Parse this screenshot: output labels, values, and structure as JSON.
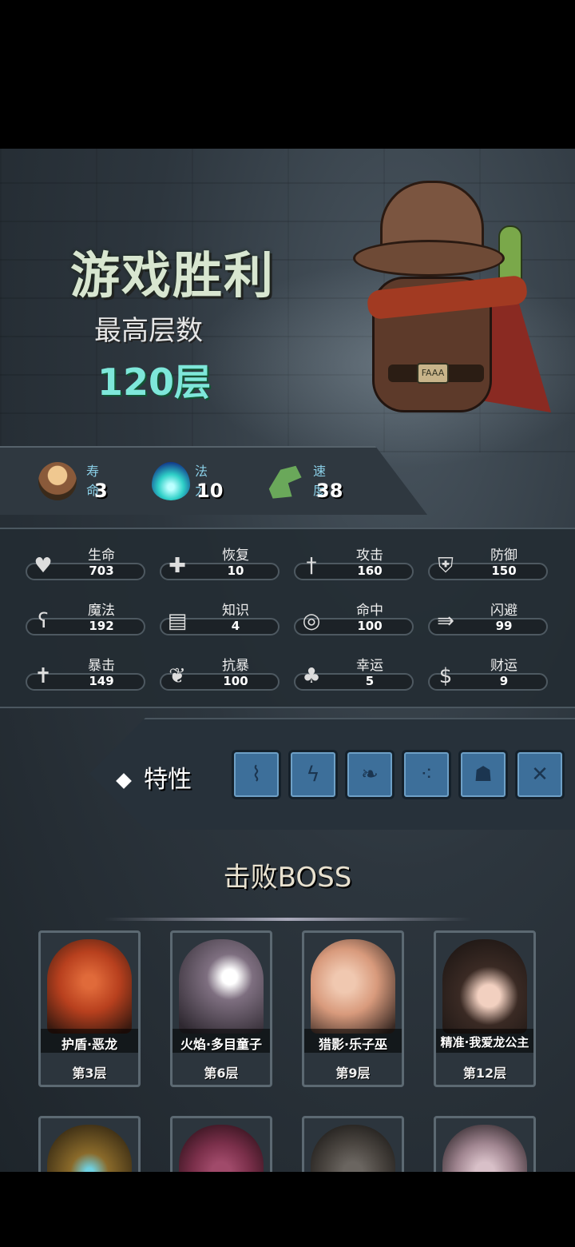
{
  "result": {
    "title": "游戏胜利",
    "floor_label": "最高层数",
    "floor_value": "120层"
  },
  "primary_stats": [
    {
      "label": "寿命",
      "value": "3",
      "icon": "lives-icon"
    },
    {
      "label": "法力",
      "value": "10",
      "icon": "mana-flame-icon"
    },
    {
      "label": "速度",
      "value": "38",
      "icon": "winged-boot-icon"
    }
  ],
  "stats": [
    {
      "label": "生命",
      "value": "703",
      "icon": "heart-icon"
    },
    {
      "label": "恢复",
      "value": "10",
      "icon": "heart-plus-icon"
    },
    {
      "label": "攻击",
      "value": "160",
      "icon": "sword-icon"
    },
    {
      "label": "防御",
      "value": "150",
      "icon": "armor-icon"
    },
    {
      "label": "魔法",
      "value": "192",
      "icon": "staff-icon"
    },
    {
      "label": "知识",
      "value": "4",
      "icon": "book-icon"
    },
    {
      "label": "命中",
      "value": "100",
      "icon": "target-icon"
    },
    {
      "label": "闪避",
      "value": "99",
      "icon": "dodge-arrows-icon"
    },
    {
      "label": "暴击",
      "value": "149",
      "icon": "crit-cross-icon"
    },
    {
      "label": "抗暴",
      "value": "100",
      "icon": "crit-resist-icon"
    },
    {
      "label": "幸运",
      "value": "5",
      "icon": "clover-icon"
    },
    {
      "label": "财运",
      "value": "9",
      "icon": "coin-icon"
    }
  ],
  "traits": {
    "label": "特性",
    "items": [
      {
        "icon": "sash-icon"
      },
      {
        "icon": "lightning-crack-icon"
      },
      {
        "icon": "leaf-branch-icon"
      },
      {
        "icon": "bullets-icon"
      },
      {
        "icon": "bandit-icon"
      },
      {
        "icon": "crossed-guns-icon"
      }
    ]
  },
  "bosses": {
    "title": "击败BOSS",
    "items": [
      {
        "name": "护盾·恶龙",
        "floor": "第3层",
        "color": "#b8401e"
      },
      {
        "name": "火焰·多目童子",
        "floor": "第6层",
        "color": "#7e6f80"
      },
      {
        "name": "猎影·乐子巫",
        "floor": "第9层",
        "color": "#d89a7c"
      },
      {
        "name": "精准·我爱龙公主",
        "floor": "第12层",
        "color": "#3a2a24"
      },
      {
        "name": "",
        "floor": "",
        "color": "#8a6a2a"
      },
      {
        "name": "",
        "floor": "",
        "color": "#7a2f4a"
      },
      {
        "name": "",
        "floor": "",
        "color": "#4a4540"
      },
      {
        "name": "",
        "floor": "",
        "color": "#a08590"
      }
    ]
  }
}
